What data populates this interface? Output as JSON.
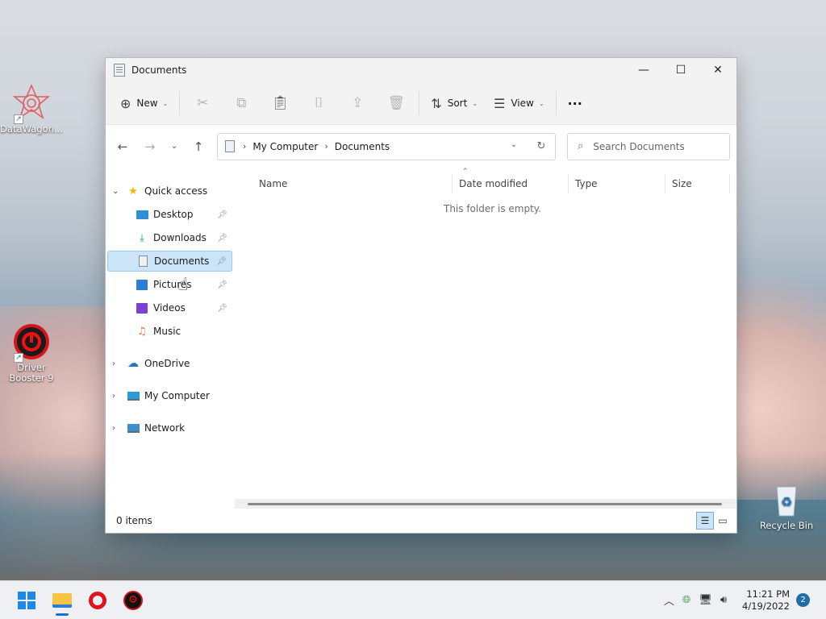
{
  "desktop": {
    "icons": [
      {
        "label": "DataWagon..."
      },
      {
        "label": "Driver Booster 9"
      },
      {
        "label": "Recycle Bin"
      }
    ]
  },
  "window": {
    "title": "Documents",
    "controls": {
      "minimize": "—",
      "maximize": "☐",
      "close": "✕"
    }
  },
  "toolbar": {
    "new_label": "New",
    "sort_label": "Sort",
    "view_label": "View",
    "more_label": "···"
  },
  "address": {
    "segments": [
      "My Computer",
      "Documents"
    ]
  },
  "search": {
    "placeholder": "Search Documents"
  },
  "sidebar": {
    "quick_access": "Quick access",
    "items": [
      {
        "label": "Desktop"
      },
      {
        "label": "Downloads"
      },
      {
        "label": "Documents"
      },
      {
        "label": "Pictures"
      },
      {
        "label": "Videos"
      },
      {
        "label": "Music"
      }
    ],
    "onedrive": "OneDrive",
    "my_computer": "My Computer",
    "network": "Network"
  },
  "columns": [
    "Name",
    "Date modified",
    "Type",
    "Size"
  ],
  "empty_message": "This folder is empty.",
  "status": {
    "items_count": "0 items"
  },
  "taskbar": {
    "time": "11:21 PM",
    "date": "4/19/2022",
    "notifications": "2"
  }
}
